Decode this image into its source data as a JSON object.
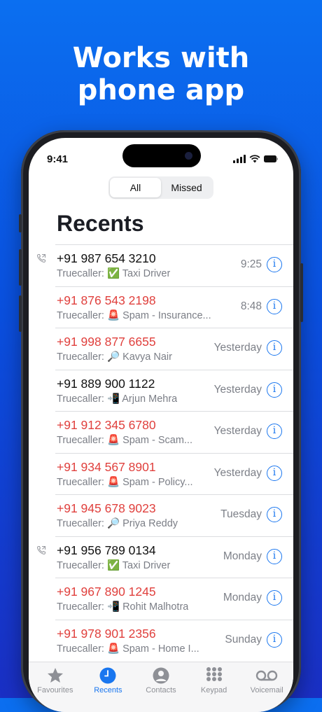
{
  "headline": {
    "line1": "Works with",
    "line2": "phone app"
  },
  "status": {
    "time": "9:41"
  },
  "segment": {
    "all": "All",
    "missed": "Missed",
    "selected": "All"
  },
  "page": {
    "title": "Recents"
  },
  "calls": [
    {
      "number": "+91 987 654 3210",
      "missed": false,
      "outgoing": true,
      "detail": "Truecaller: ✅ Taxi Driver",
      "time": "9:25"
    },
    {
      "number": "+91 876 543 2198",
      "missed": true,
      "outgoing": false,
      "detail": "Truecaller: 🚨 Spam - Insurance...",
      "time": "8:48"
    },
    {
      "number": "+91 998 877 6655",
      "missed": true,
      "outgoing": false,
      "detail": "Truecaller: 🔎 Kavya Nair",
      "time": "Yesterday"
    },
    {
      "number": "+91 889 900 1122",
      "missed": false,
      "outgoing": false,
      "detail": "Truecaller: 📲 Arjun Mehra",
      "time": "Yesterday"
    },
    {
      "number": "+91 912 345 6780",
      "missed": true,
      "outgoing": false,
      "detail": "Truecaller: 🚨 Spam - Scam...",
      "time": "Yesterday"
    },
    {
      "number": "+91 934 567 8901",
      "missed": true,
      "outgoing": false,
      "detail": "Truecaller: 🚨 Spam - Policy...",
      "time": "Yesterday"
    },
    {
      "number": "+91 945 678 9023",
      "missed": true,
      "outgoing": false,
      "detail": "Truecaller: 🔎 Priya Reddy",
      "time": "Tuesday"
    },
    {
      "number": "+91 956 789 0134",
      "missed": false,
      "outgoing": true,
      "detail": "Truecaller: ✅ Taxi Driver",
      "time": "Monday"
    },
    {
      "number": "+91 967 890 1245",
      "missed": true,
      "outgoing": false,
      "detail": "Truecaller: 📲 Rohit Malhotra",
      "time": "Monday"
    },
    {
      "number": "+91 978 901 2356",
      "missed": true,
      "outgoing": false,
      "detail": "Truecaller: 🚨 Spam - Home I...",
      "time": "Sunday"
    }
  ],
  "tabs": [
    {
      "label": "Favourites",
      "icon": "star-icon",
      "active": false
    },
    {
      "label": "Recents",
      "icon": "clock-icon",
      "active": true
    },
    {
      "label": "Contacts",
      "icon": "person-icon",
      "active": false
    },
    {
      "label": "Keypad",
      "icon": "keypad-icon",
      "active": false
    },
    {
      "label": "Voicemail",
      "icon": "voicemail-icon",
      "active": false
    }
  ],
  "colors": {
    "accent": "#1976EF",
    "missed": "#E0403D",
    "background": "#0B6FF0"
  }
}
